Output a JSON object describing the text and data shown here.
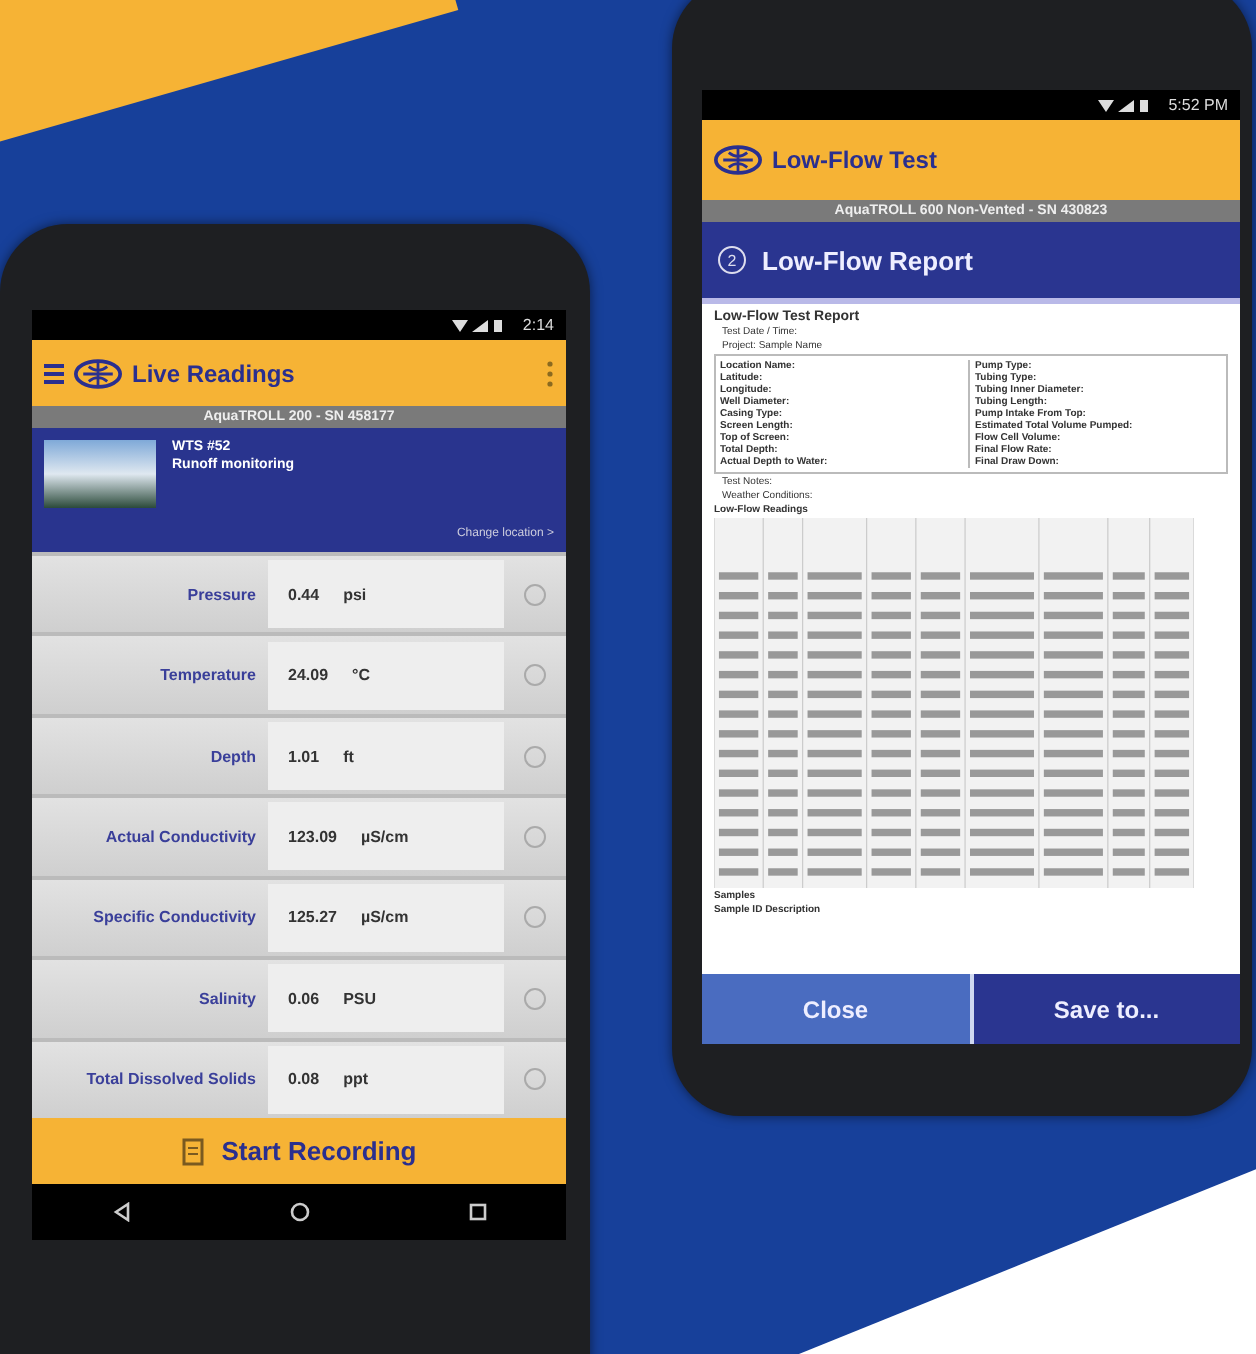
{
  "live_phone": {
    "status_bar": {
      "time": "2:14"
    },
    "app_bar": {
      "title": "Live Readings"
    },
    "device": "AquaTROLL 200 - SN 458177",
    "site": {
      "name": "WTS #52",
      "description": "Runoff monitoring",
      "change_link": "Change location >"
    },
    "readings": [
      {
        "label": "Pressure",
        "value": "0.44",
        "unit": "psi",
        "selected": false
      },
      {
        "label": "Temperature",
        "value": "24.09",
        "unit": "°C",
        "selected": false
      },
      {
        "label": "Depth",
        "value": "1.01",
        "unit": "ft",
        "selected": false
      },
      {
        "label": "Actual Conductivity",
        "value": "123.09",
        "unit": "µS/cm",
        "selected": false
      },
      {
        "label": "Specific Conductivity",
        "value": "125.27",
        "unit": "µS/cm",
        "selected": false
      },
      {
        "label": "Salinity",
        "value": "0.06",
        "unit": "PSU",
        "selected": false
      },
      {
        "label": "Total Dissolved Solids",
        "value": "0.08",
        "unit": "ppt",
        "selected": false
      }
    ],
    "record_button": "Start Recording"
  },
  "report_phone": {
    "status_bar": {
      "time": "5:52 PM"
    },
    "app_bar": {
      "title": "Low-Flow Test"
    },
    "device": "AquaTROLL 600 Non-Vented - SN 430823",
    "header": {
      "step": "2",
      "title": "Low-Flow Report"
    },
    "report": {
      "title": "Low-Flow Test Report",
      "meta": [
        "Test Date / Time:",
        "Project:      Sample Name"
      ],
      "left_fields": [
        "Location Name:",
        "Latitude:",
        "Longitude:",
        "Well Diameter:",
        "Casing Type:",
        "Screen Length:",
        "Top of Screen:",
        "Total Depth:",
        "Actual Depth to Water:"
      ],
      "right_fields": [
        "Pump Type:",
        "Tubing Type:",
        "Tubing Inner Diameter:",
        "Tubing Length:",
        "Pump Intake From Top:",
        "Estimated Total Volume Pumped:",
        "Flow Cell Volume:",
        "Final Flow Rate:",
        "Final Draw Down:"
      ],
      "notes": [
        "Test Notes:",
        "Weather Conditions:"
      ],
      "readings_title": "Low-Flow Readings",
      "samples_title": "Samples",
      "samples_header": "Sample ID  Description"
    },
    "buttons": [
      {
        "label": "Close",
        "kind": "secondary"
      },
      {
        "label": "Save to...",
        "kind": "primary"
      }
    ]
  }
}
